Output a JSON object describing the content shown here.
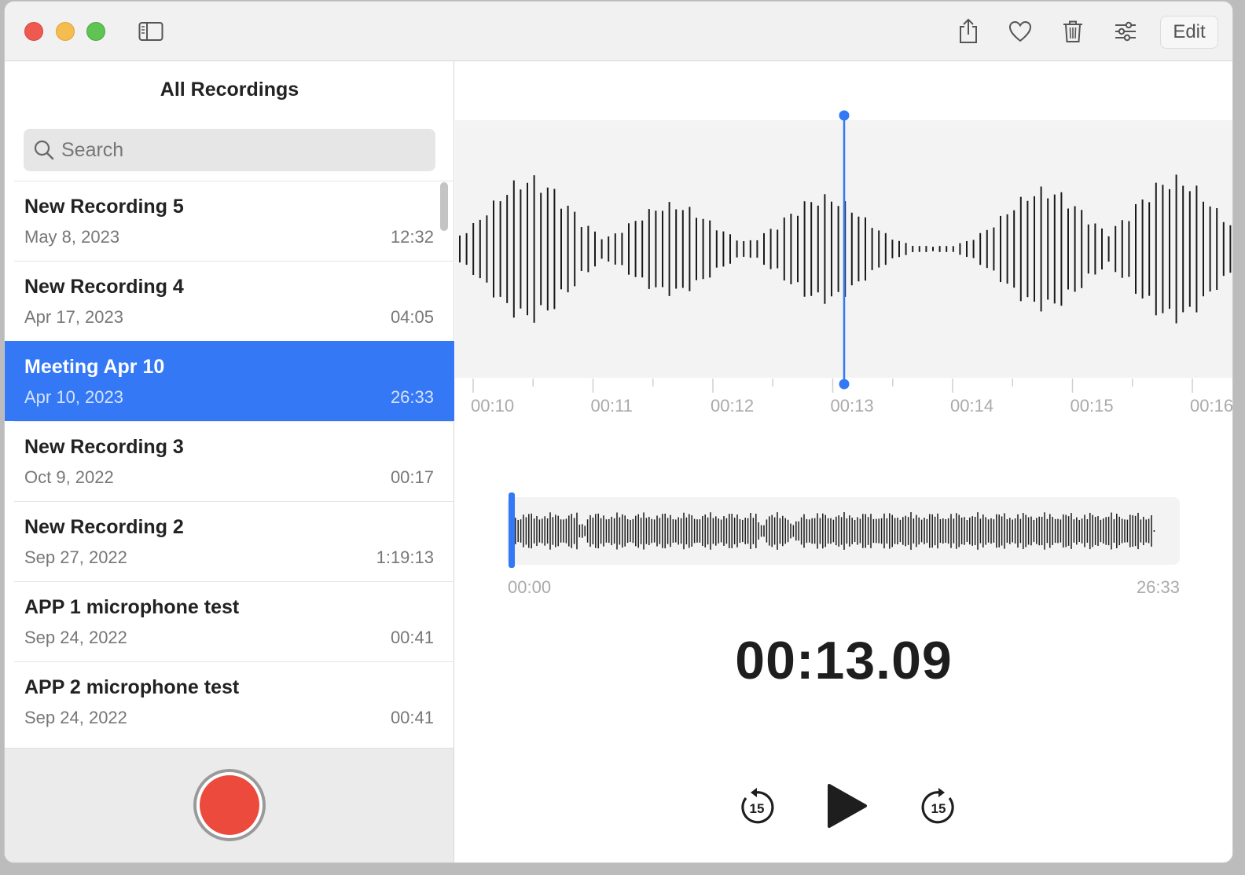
{
  "toolbar": {
    "edit_label": "Edit",
    "icons": [
      "sidebar-toggle-icon",
      "share-icon",
      "heart-icon",
      "trash-icon",
      "sliders-icon"
    ]
  },
  "sidebar": {
    "title": "All Recordings",
    "search_placeholder": "Search",
    "recordings": [
      {
        "name": "New Recording 5",
        "date": "May 8, 2023",
        "duration": "12:32"
      },
      {
        "name": "New Recording 4",
        "date": "Apr 17, 2023",
        "duration": "04:05"
      },
      {
        "name": "Meeting Apr 10",
        "date": "Apr 10, 2023",
        "duration": "26:33"
      },
      {
        "name": "New Recording 3",
        "date": "Oct 9, 2022",
        "duration": "00:17"
      },
      {
        "name": "New Recording 2",
        "date": "Sep 27, 2022",
        "duration": "1:19:13"
      },
      {
        "name": "APP 1 microphone test",
        "date": "Sep 24, 2022",
        "duration": "00:41"
      },
      {
        "name": "APP 2 microphone test",
        "date": "Sep 24, 2022",
        "duration": "00:41"
      }
    ],
    "selected_index": 2
  },
  "player": {
    "timeline_ticks": [
      "00:10",
      "00:11",
      "00:12",
      "00:13",
      "00:14",
      "00:15",
      "00:16"
    ],
    "overview_start": "00:00",
    "overview_end": "26:33",
    "current_time": "00:13.09",
    "skip_seconds": "15",
    "accent_color": "#3478f6",
    "record_color": "#ec4a3c"
  }
}
